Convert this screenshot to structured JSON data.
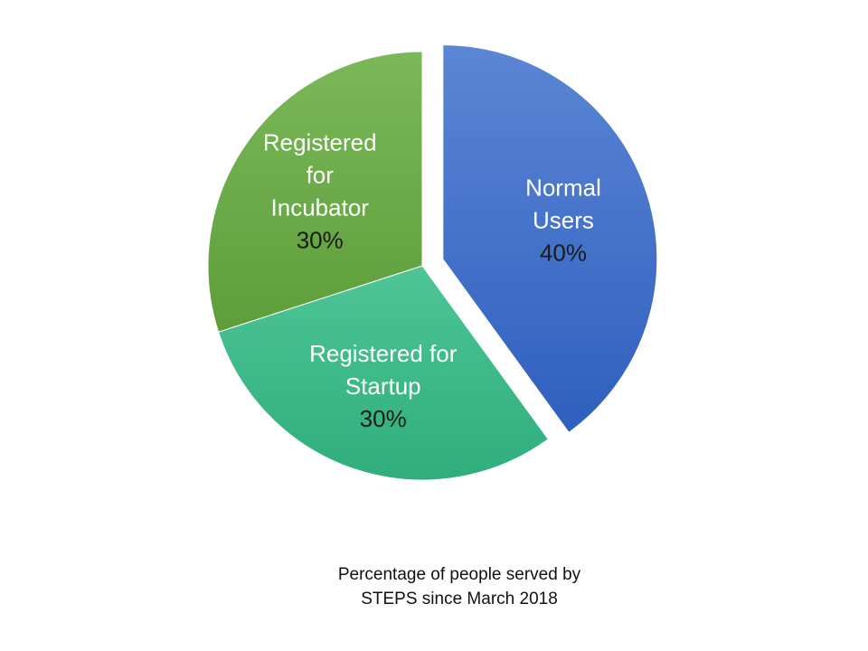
{
  "chart_data": {
    "type": "pie",
    "slices": [
      {
        "label_lines": [
          "Normal",
          "Users"
        ],
        "percent_label": "40%",
        "value": 40,
        "colors": [
          "#5b86d4",
          "#2f5fbf"
        ],
        "exploded": true
      },
      {
        "label_lines": [
          "Registered for",
          "Startup"
        ],
        "percent_label": "30%",
        "value": 30,
        "colors": [
          "#4ec596",
          "#2fae7c"
        ],
        "exploded": false
      },
      {
        "label_lines": [
          "Registered",
          "for",
          "Incubator"
        ],
        "percent_label": "30%",
        "value": 30,
        "colors": [
          "#7ab85a",
          "#5e9e39"
        ],
        "exploded": false
      }
    ],
    "start_angle_deg": 0,
    "direction": "clockwise",
    "legend": "none"
  },
  "caption": {
    "line1": "Percentage of people served by",
    "line2": "STEPS since March 2018"
  }
}
